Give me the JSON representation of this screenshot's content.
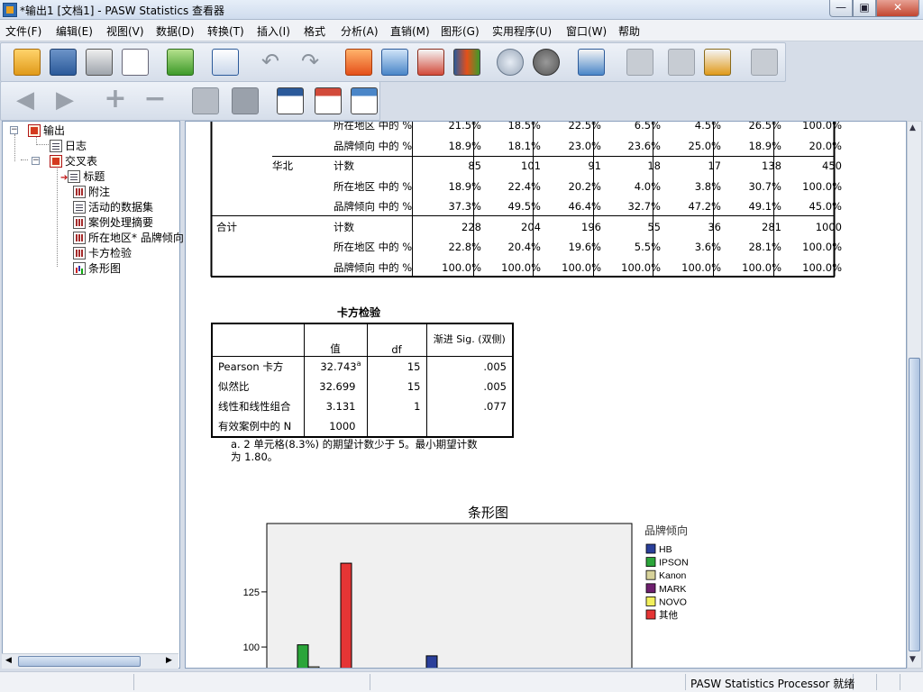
{
  "window": {
    "title": "*输出1 [文档1] - PASW Statistics 查看器",
    "min_glyph": "—",
    "max_glyph": "▣",
    "close_glyph": "✕"
  },
  "menu": [
    "文件(F)",
    "编辑(E)",
    "视图(V)",
    "数据(D)",
    "转换(T)",
    "插入(I)",
    "格式",
    "分析(A)",
    "直销(M)",
    "图形(G)",
    "实用程序(U)",
    "窗口(W)",
    "帮助"
  ],
  "tree": {
    "items": [
      {
        "label": "输出",
        "icon": "output-icon"
      },
      {
        "label": "日志",
        "icon": "log-icon"
      },
      {
        "label": "交叉表",
        "icon": "crosstab-icon"
      },
      {
        "label": "标题",
        "icon": "title-icon"
      },
      {
        "label": "附注",
        "icon": "notes-icon"
      },
      {
        "label": "活动的数据集",
        "icon": "dataset-icon"
      },
      {
        "label": "案例处理摘要",
        "icon": "table-icon"
      },
      {
        "label": "所在地区* 品牌倾向",
        "icon": "table-icon"
      },
      {
        "label": "卡方检验",
        "icon": "table-icon"
      },
      {
        "label": "条形图",
        "icon": "chart-icon"
      }
    ],
    "expand_minus": "−"
  },
  "crosstab": {
    "rows": [
      {
        "group": "",
        "sub": "",
        "label": "所在地区 中的 %",
        "values": [
          "21.5%",
          "18.5%",
          "22.5%",
          "6.5%",
          "4.5%",
          "26.5%",
          "100.0%"
        ]
      },
      {
        "group": "",
        "sub": "",
        "label": "品牌倾向 中的 %",
        "values": [
          "18.9%",
          "18.1%",
          "23.0%",
          "23.6%",
          "25.0%",
          "18.9%",
          "20.0%"
        ]
      },
      {
        "group": "",
        "sub": "华北",
        "label": "计数",
        "values": [
          "85",
          "101",
          "91",
          "18",
          "17",
          "138",
          "450"
        ]
      },
      {
        "group": "",
        "sub": "",
        "label": "所在地区 中的 %",
        "values": [
          "18.9%",
          "22.4%",
          "20.2%",
          "4.0%",
          "3.8%",
          "30.7%",
          "100.0%"
        ]
      },
      {
        "group": "",
        "sub": "",
        "label": "品牌倾向 中的 %",
        "values": [
          "37.3%",
          "49.5%",
          "46.4%",
          "32.7%",
          "47.2%",
          "49.1%",
          "45.0%"
        ]
      },
      {
        "group": "合计",
        "sub": "",
        "label": "计数",
        "values": [
          "228",
          "204",
          "196",
          "55",
          "36",
          "281",
          "1000"
        ]
      },
      {
        "group": "",
        "sub": "",
        "label": "所在地区 中的 %",
        "values": [
          "22.8%",
          "20.4%",
          "19.6%",
          "5.5%",
          "3.6%",
          "28.1%",
          "100.0%"
        ]
      },
      {
        "group": "",
        "sub": "",
        "label": "品牌倾向 中的 %",
        "values": [
          "100.0%",
          "100.0%",
          "100.0%",
          "100.0%",
          "100.0%",
          "100.0%",
          "100.0%"
        ]
      }
    ]
  },
  "chi": {
    "title": "卡方检验",
    "headers": [
      "",
      "值",
      "df",
      "渐进 Sig. (双侧)"
    ],
    "rows": [
      {
        "label": "Pearson 卡方",
        "value": "32.743",
        "sup": "a",
        "df": "15",
        "sig": ".005"
      },
      {
        "label": "似然比",
        "value": "32.699",
        "sup": "",
        "df": "15",
        "sig": ".005"
      },
      {
        "label": "线性和线性组合",
        "value": "3.131",
        "sup": "",
        "df": "1",
        "sig": ".077"
      },
      {
        "label": "有效案例中的 N",
        "value": "1000",
        "sup": "",
        "df": "",
        "sig": ""
      }
    ],
    "footnote_line1": "a. 2 单元格(8.3%) 的期望计数少于 5。最小期望计数",
    "footnote_line2": "为 1.80。"
  },
  "chart_data": {
    "type": "bar",
    "title": "条形图",
    "legend_title": "品牌倾向",
    "legend_position": "right",
    "series": [
      {
        "name": "HB",
        "color": "#2a3f9a"
      },
      {
        "name": "IPSON",
        "color": "#2ba53a"
      },
      {
        "name": "Kanon",
        "color": "#d7d29a"
      },
      {
        "name": "MARK",
        "color": "#6e1f6e"
      },
      {
        "name": "NOVO",
        "color": "#f2ef5c"
      },
      {
        "name": "其他",
        "color": "#e53535"
      }
    ],
    "yticks": [
      100,
      125
    ],
    "ylim": [
      89,
      156
    ],
    "bars": [
      {
        "group": 1,
        "series": "IPSON",
        "value": 101
      },
      {
        "group": 1,
        "series": "Kanon",
        "value": 91
      },
      {
        "group": 1,
        "series": "其他",
        "value": 138
      },
      {
        "group": 2,
        "series": "HB",
        "value": 96
      }
    ],
    "grid": false
  },
  "status": {
    "text": "PASW Statistics Processor 就绪"
  },
  "colors": {
    "toolbar_bg": "#d6deea",
    "selection_blue": "#2f6db5"
  }
}
